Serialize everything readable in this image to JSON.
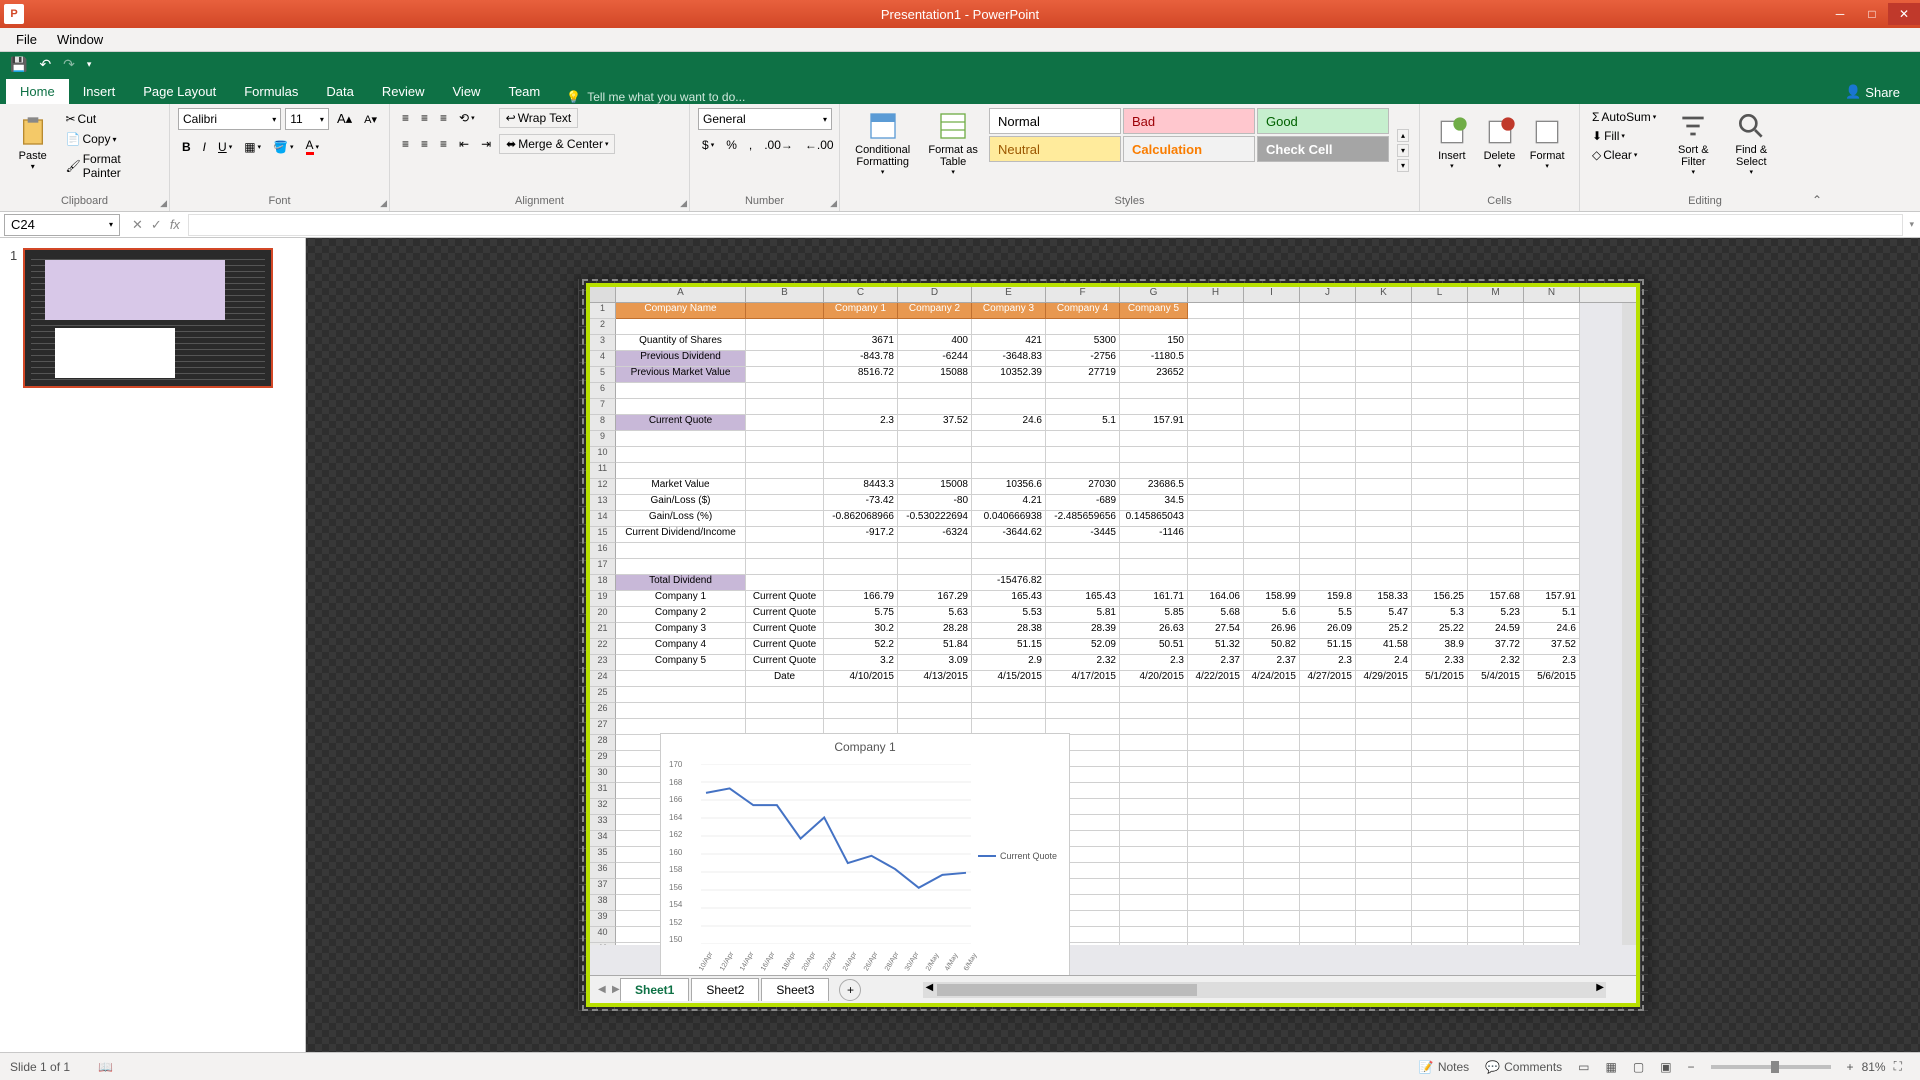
{
  "app": {
    "title": "Presentation1 - PowerPoint",
    "icon_letter": "P"
  },
  "menubar": {
    "file": "File",
    "window": "Window"
  },
  "tabs": {
    "home": "Home",
    "insert": "Insert",
    "page_layout": "Page Layout",
    "formulas": "Formulas",
    "data": "Data",
    "review": "Review",
    "view": "View",
    "team": "Team",
    "tell_me": "Tell me what you want to do...",
    "share": "Share"
  },
  "ribbon": {
    "clipboard": {
      "paste": "Paste",
      "cut": "Cut",
      "copy": "Copy",
      "format_painter": "Format Painter",
      "label": "Clipboard"
    },
    "font": {
      "name": "Calibri",
      "size": "11",
      "label": "Font"
    },
    "alignment": {
      "wrap": "Wrap Text",
      "merge": "Merge & Center",
      "label": "Alignment"
    },
    "number": {
      "format": "General",
      "label": "Number"
    },
    "styles": {
      "cond": "Conditional Formatting",
      "fat": "Format as Table",
      "normal": "Normal",
      "bad": "Bad",
      "good": "Good",
      "neutral": "Neutral",
      "calculation": "Calculation",
      "check": "Check Cell",
      "label": "Styles"
    },
    "cells": {
      "insert": "Insert",
      "delete": "Delete",
      "format": "Format",
      "label": "Cells"
    },
    "editing": {
      "autosum": "AutoSum",
      "fill": "Fill",
      "clear": "Clear",
      "sort": "Sort & Filter",
      "find": "Find & Select",
      "label": "Editing"
    }
  },
  "formula_bar": {
    "name_box": "C24",
    "fx": "fx"
  },
  "thumb": {
    "num": "1"
  },
  "sheet": {
    "cols": [
      "A",
      "B",
      "C",
      "D",
      "E",
      "F",
      "G",
      "H",
      "I",
      "J",
      "K",
      "L",
      "M",
      "N"
    ],
    "headers": {
      "company_name": "Company Name",
      "c1": "Company 1",
      "c2": "Company 2",
      "c3": "Company 3",
      "c4": "Company 4",
      "c5": "Company 5"
    },
    "labels": {
      "qty": "Quantity of Shares",
      "prev_div": "Previous Dividend",
      "prev_mv": "Previous Market Value",
      "cur_quote": "Current Quote",
      "mv": "Market Value",
      "gl_d": "Gain/Loss ($)",
      "gl_p": "Gain/Loss (%)",
      "cdi": "Current Dividend/Income",
      "tot_div": "Total Dividend",
      "co1": "Company 1",
      "co2": "Company 2",
      "co3": "Company 3",
      "co4": "Company 4",
      "co5": "Company 5",
      "cq": "Current Quote",
      "date": "Date"
    },
    "data": {
      "qty": [
        "3671",
        "400",
        "421",
        "5300",
        "150"
      ],
      "prev_div": [
        "-843.78",
        "-6244",
        "-3648.83",
        "-2756",
        "-1180.5"
      ],
      "prev_mv": [
        "8516.72",
        "15088",
        "10352.39",
        "27719",
        "23652"
      ],
      "cur_quote": [
        "2.3",
        "37.52",
        "24.6",
        "5.1",
        "157.91"
      ],
      "mv": [
        "8443.3",
        "15008",
        "10356.6",
        "27030",
        "23686.5"
      ],
      "gl_d": [
        "-73.42",
        "-80",
        "4.21",
        "-689",
        "34.5"
      ],
      "gl_p": [
        "-0.862068966",
        "-0.530222694",
        "0.040666938",
        "-2.485659656",
        "0.145865043"
      ],
      "cdi": [
        "-917.2",
        "-6324",
        "-3644.62",
        "-3445",
        "-1146"
      ],
      "tot_div": "-15476.82",
      "co1": [
        "166.79",
        "167.29",
        "165.43",
        "165.43",
        "161.71",
        "164.06",
        "158.99",
        "159.8",
        "158.33",
        "156.25",
        "157.68",
        "157.91"
      ],
      "co2": [
        "5.75",
        "5.63",
        "5.53",
        "5.81",
        "5.85",
        "5.68",
        "5.6",
        "5.5",
        "5.47",
        "5.3",
        "5.23",
        "5.1"
      ],
      "co3": [
        "30.2",
        "28.28",
        "28.38",
        "28.39",
        "26.63",
        "27.54",
        "26.96",
        "26.09",
        "25.2",
        "25.22",
        "24.59",
        "24.6"
      ],
      "co4": [
        "52.2",
        "51.84",
        "51.15",
        "52.09",
        "50.51",
        "51.32",
        "50.82",
        "51.15",
        "41.58",
        "38.9",
        "37.72",
        "37.52"
      ],
      "co5": [
        "3.2",
        "3.09",
        "2.9",
        "2.32",
        "2.3",
        "2.37",
        "2.37",
        "2.3",
        "2.4",
        "2.33",
        "2.32",
        "2.3"
      ],
      "dates": [
        "4/10/2015",
        "4/13/2015",
        "4/15/2015",
        "4/17/2015",
        "4/20/2015",
        "4/22/2015",
        "4/24/2015",
        "4/27/2015",
        "4/29/2015",
        "5/1/2015",
        "5/4/2015",
        "5/6/2015"
      ]
    },
    "tabs": {
      "s1": "Sheet1",
      "s2": "Sheet2",
      "s3": "Sheet3"
    }
  },
  "chart_data": {
    "type": "line",
    "title": "Company 1",
    "series": [
      {
        "name": "Current Quote",
        "values": [
          166.79,
          167.29,
          165.43,
          165.43,
          161.71,
          164.06,
          158.99,
          159.8,
          158.33,
          156.25,
          157.68,
          157.91
        ]
      }
    ],
    "categories": [
      "10/Apr",
      "12/Apr",
      "14/Apr",
      "16/Apr",
      "18/Apr",
      "20/Apr",
      "22/Apr",
      "24/Apr",
      "26/Apr",
      "28/Apr",
      "30/Apr",
      "2/May",
      "4/May",
      "6/May"
    ],
    "ylim": [
      150,
      170
    ],
    "yticks": [
      170,
      168,
      166,
      164,
      162,
      160,
      158,
      156,
      154,
      152,
      150
    ],
    "xlabel": "",
    "ylabel": "",
    "legend": "Current Quote"
  },
  "statusbar": {
    "slide": "Slide 1 of 1",
    "notes": "Notes",
    "comments": "Comments",
    "zoom": "81%"
  }
}
